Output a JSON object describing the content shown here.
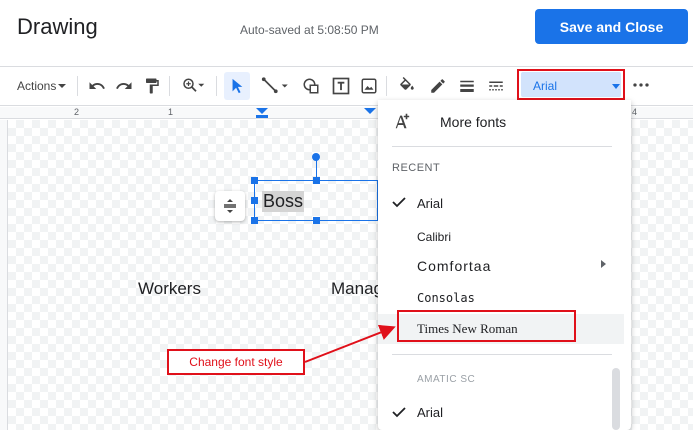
{
  "header": {
    "title": "Drawing",
    "autosave": "Auto-saved at 5:08:50 PM",
    "save_button": "Save and Close"
  },
  "toolbar": {
    "actions_label": "Actions",
    "font_label": "Arial",
    "icons": [
      "undo-icon",
      "redo-icon",
      "paint-format-icon",
      "zoom-icon",
      "select-icon",
      "line-icon",
      "shape-icon",
      "textbox-icon",
      "image-icon",
      "fill-color-icon",
      "border-color-icon",
      "border-weight-icon",
      "border-dash-icon",
      "more-icon"
    ]
  },
  "ruler": {
    "ticks": [
      "2",
      "1",
      "4"
    ]
  },
  "canvas": {
    "boss_text": "Boss",
    "workers_text": "Workers",
    "managers_text": "Manag"
  },
  "font_menu": {
    "more_fonts": "More fonts",
    "recent_header": "RECENT",
    "recent": [
      "Arial",
      "Calibri",
      "Comfortaa",
      "Consolas",
      "Times New Roman"
    ],
    "all_header": "AMATIC SC",
    "all": [
      "Arial"
    ],
    "selected": "Arial"
  },
  "annotation": {
    "text": "Change font style",
    "color": "#e0101a"
  },
  "colors": {
    "accent": "#1a73e8",
    "annotation": "#e0101a"
  }
}
